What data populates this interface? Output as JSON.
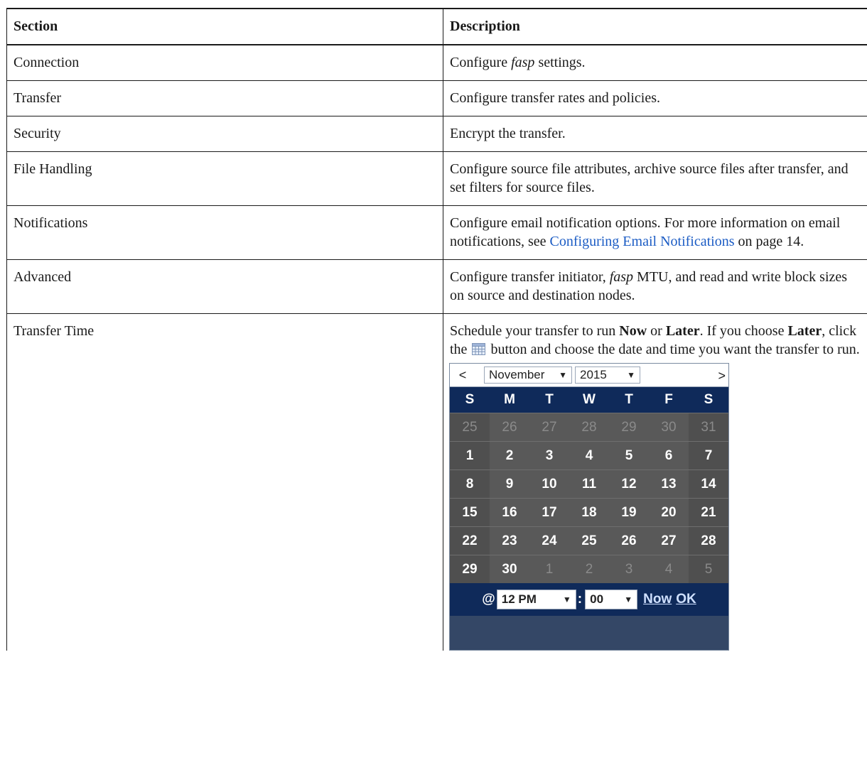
{
  "table": {
    "headers": {
      "section": "Section",
      "description": "Description"
    },
    "rows": [
      {
        "section": "Connection",
        "desc": [
          "Configure ",
          "fasp",
          " settings."
        ]
      },
      {
        "section": "Transfer",
        "desc": "Configure transfer rates and policies."
      },
      {
        "section": "Security",
        "desc": "Encrypt the transfer."
      },
      {
        "section": "File Handling",
        "desc": "Configure source file attributes, archive source files after transfer, and set filters for source files."
      },
      {
        "section": "Notifications",
        "desc_pre": "Configure email notification options. For more information on email notifications, see ",
        "link": "Configuring Email Notifications",
        "desc_post": " on page 14."
      },
      {
        "section": "Advanced",
        "desc_pre": "Configure transfer initiator, ",
        "ital": "fasp",
        "desc_post": " MTU, and read and write block sizes on source and destination nodes."
      },
      {
        "section": "Transfer Time",
        "p1": "Schedule your transfer to run ",
        "now": "Now",
        "p2": " or ",
        "later": "Later",
        "p3": ". If you choose ",
        "later2": "Later",
        "p4": ", click the ",
        "p5": " button and choose the date and time you want the transfer to run."
      }
    ]
  },
  "calendar": {
    "prev": "<",
    "next": ">",
    "month": "November",
    "year": "2015",
    "weekdays": [
      "S",
      "M",
      "T",
      "W",
      "T",
      "F",
      "S"
    ],
    "weeks": [
      [
        "25",
        "26",
        "27",
        "28",
        "29",
        "30",
        "31"
      ],
      [
        "1",
        "2",
        "3",
        "4",
        "5",
        "6",
        "7"
      ],
      [
        "8",
        "9",
        "10",
        "11",
        "12",
        "13",
        "14"
      ],
      [
        "15",
        "16",
        "17",
        "18",
        "19",
        "20",
        "21"
      ],
      [
        "22",
        "23",
        "24",
        "25",
        "26",
        "27",
        "28"
      ],
      [
        "29",
        "30",
        "1",
        "2",
        "3",
        "4",
        "5"
      ]
    ],
    "out_of_month": [
      [
        0,
        0
      ],
      [
        0,
        1
      ],
      [
        0,
        2
      ],
      [
        0,
        3
      ],
      [
        0,
        4
      ],
      [
        0,
        5
      ],
      [
        0,
        6
      ],
      [
        5,
        2
      ],
      [
        5,
        3
      ],
      [
        5,
        4
      ],
      [
        5,
        5
      ],
      [
        5,
        6
      ]
    ],
    "footer": {
      "at": "@",
      "hour": "12 PM",
      "colon": ":",
      "minute": "00",
      "now": "Now",
      "ok": "OK"
    },
    "dropdown_arrow": "▼",
    "icon": "calendar-icon",
    "colors": {
      "header": "#0f2a5a",
      "grid": "#595959",
      "link": "#1a5bc4"
    }
  }
}
